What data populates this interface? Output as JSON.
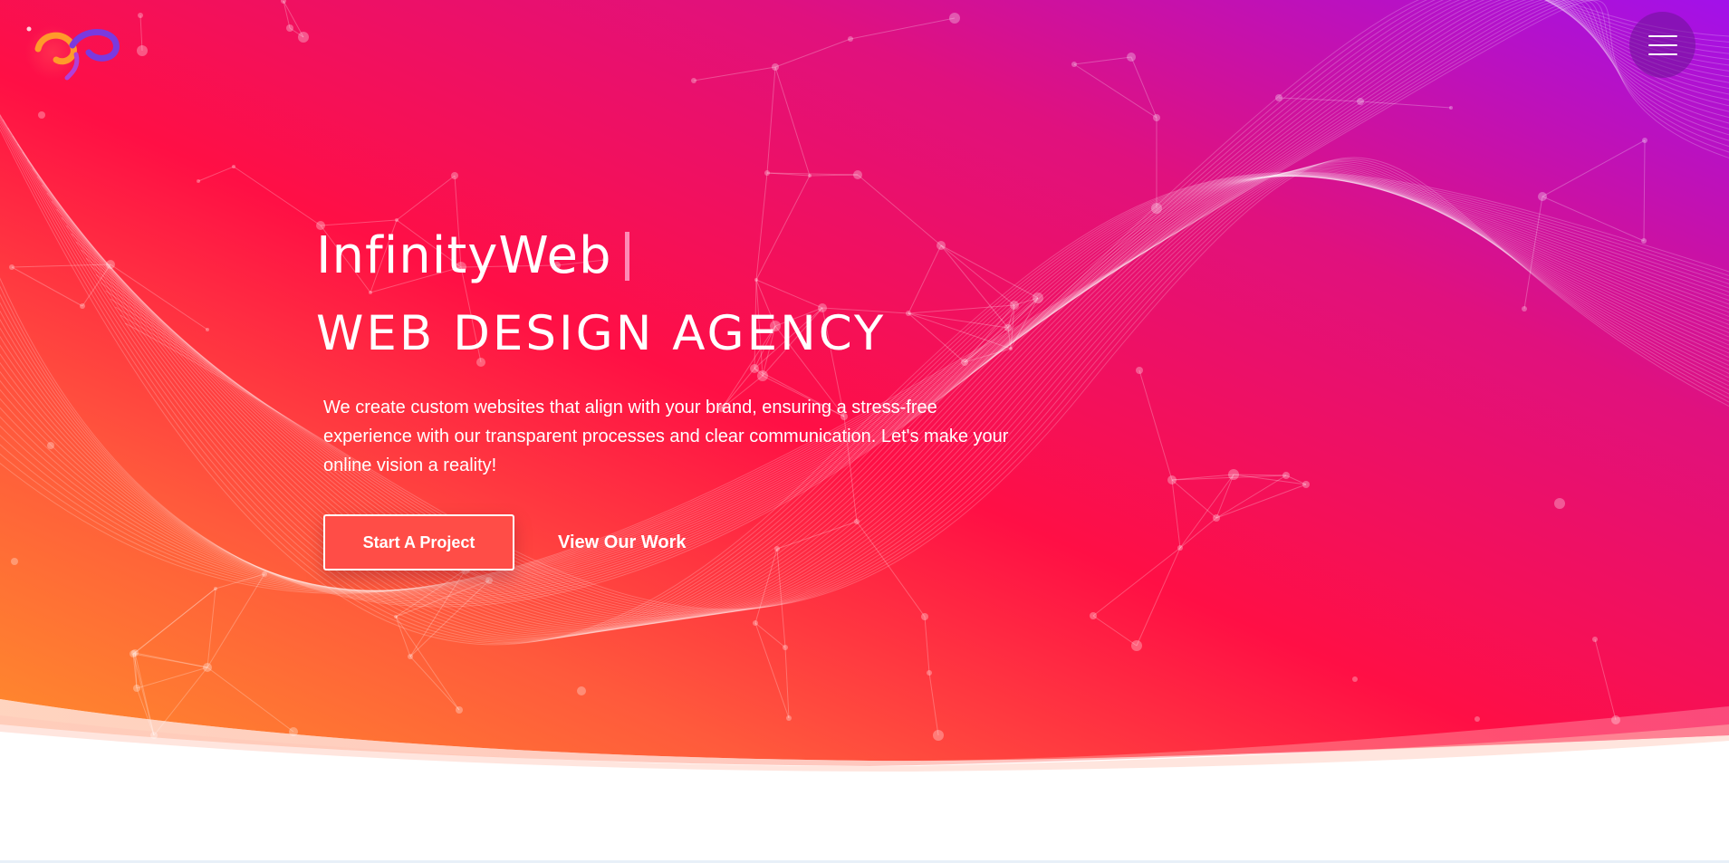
{
  "site": {
    "brand_name": "InfinityWeb",
    "tagline": "WEB DESIGN AGENCY",
    "description": "We create custom websites that align with your brand, ensuring a stress-free experience with our transparent processes and clear communication. Let's make your online vision a reality!"
  },
  "cta": {
    "primary_label": "Start A Project",
    "secondary_label": "View Our Work"
  },
  "icons": {
    "logo": "infinity-logo-icon",
    "menu": "hamburger-menu-icon"
  },
  "colors": {
    "gradient_orange": "#ff8a2a",
    "gradient_red": "#ff0f4a",
    "gradient_magenta": "#e0119a",
    "gradient_purple": "#a511e8",
    "button_fill": "#ff4d47",
    "text": "#ffffff"
  }
}
